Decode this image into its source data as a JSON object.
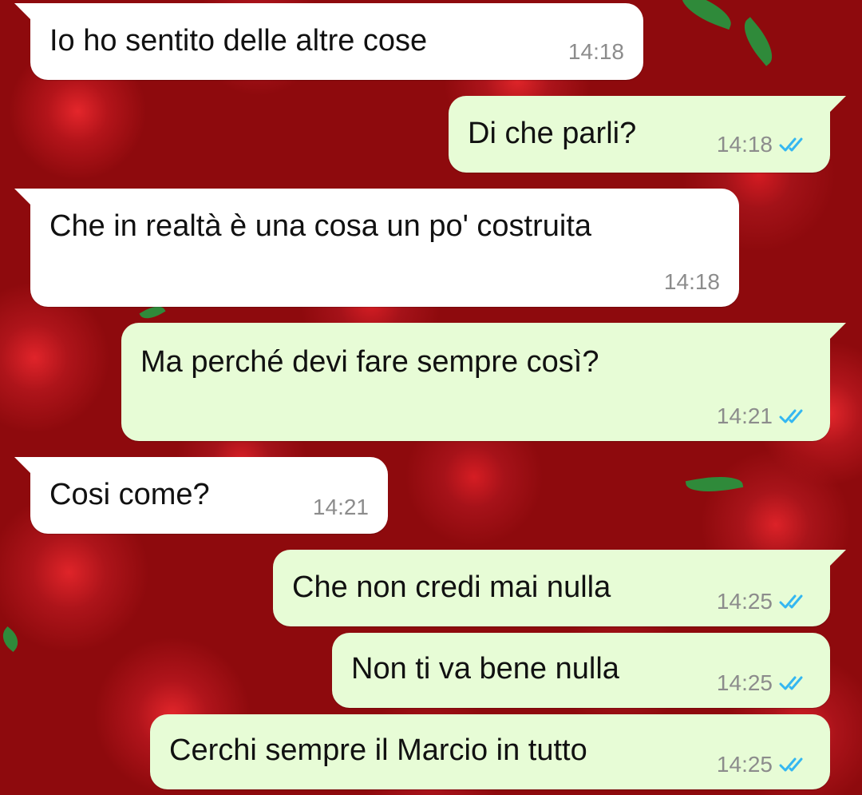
{
  "theme": {
    "incoming_bubble": "#ffffff",
    "outgoing_bubble": "#e7fcd6",
    "read_tick": "#34b7f1",
    "time_text": "#8c8c8c"
  },
  "wallpaper": {
    "description_icon": "red-roses-wallpaper"
  },
  "messages": [
    {
      "direction": "in",
      "text": "Io ho sentito delle altre cose",
      "time": "14:18"
    },
    {
      "direction": "out",
      "text": "Di che parli?",
      "time": "14:18",
      "status": "read"
    },
    {
      "direction": "in",
      "text": "Che in realtà è una cosa un po' costruita",
      "time": "14:18"
    },
    {
      "direction": "out",
      "text": "Ma perché devi fare sempre così?",
      "time": "14:21",
      "status": "read"
    },
    {
      "direction": "in",
      "text": "Cosi come?",
      "time": "14:21"
    },
    {
      "direction": "out",
      "text": "Che non credi mai nulla",
      "time": "14:25",
      "status": "read"
    },
    {
      "direction": "out",
      "text": "Non ti va bene nulla",
      "time": "14:25",
      "status": "read"
    },
    {
      "direction": "out",
      "text": "Cerchi sempre il Marcio in tutto",
      "time": "14:25",
      "status": "read"
    }
  ]
}
